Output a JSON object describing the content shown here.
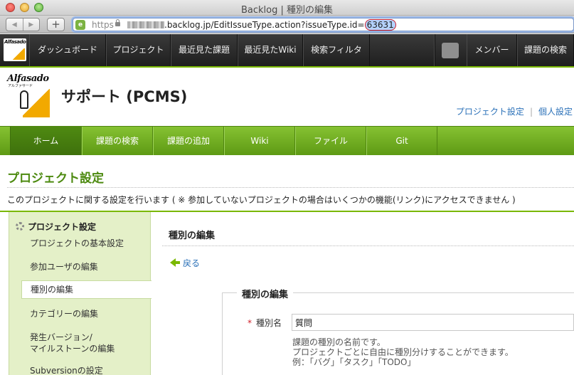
{
  "window": {
    "title": "Backlog | 種別の編集"
  },
  "address_bar": {
    "protocol": "https",
    "url_visible": ".backlog.jp/EditIssueType.action?issueType.id=",
    "url_id": "63631"
  },
  "global_nav": {
    "logo_text": "Alfasado",
    "items": [
      "ダッシュボード",
      "プロジェクト",
      "最近見た課題",
      "最近見たWiki",
      "検索フィルタ"
    ],
    "right_items": [
      "メンバー",
      "課題の検索"
    ]
  },
  "project": {
    "logo_text": "Alfasado",
    "logo_sub": "アルファサード",
    "name": "サポート (PCMS)",
    "links": [
      "プロジェクト設定",
      "個人設定"
    ]
  },
  "project_nav": {
    "items": [
      "ホーム",
      "課題の検索",
      "課題の追加",
      "Wiki",
      "ファイル",
      "Git"
    ],
    "active_index": 0
  },
  "page": {
    "title": "プロジェクト設定",
    "description": "このプロジェクトに関する設定を行います ( ※ 参加していないプロジェクトの場合はいくつかの機能(リンク)にアクセスできません )"
  },
  "sidebar": {
    "heading": "プロジェクト設定",
    "items": [
      {
        "label": "プロジェクトの基本設定"
      },
      {
        "label": "参加ユーザの編集"
      },
      {
        "label": "種別の編集",
        "active": true
      },
      {
        "label": "カテゴリーの編集"
      },
      {
        "label_line1": "発生バージョン/",
        "label_line2": "マイルストーンの編集"
      },
      {
        "label": "Subversionの設定"
      }
    ]
  },
  "main": {
    "title": "種別の編集",
    "back_label": "戻る",
    "form": {
      "legend": "種別の編集",
      "required_mark": "*",
      "field_label": "種別名",
      "field_value": "質問",
      "help_lines": [
        "課題の種別の名前です。",
        "プロジェクトごとに自由に種別分けすることができます。",
        "例：「バグ」「タスク」「TODO」"
      ]
    }
  },
  "colors": {
    "brand_green": "#7ab800",
    "title_green": "#4d8a10",
    "link_blue": "#2a70b8",
    "sidebar_bg": "#e4f0c8",
    "required_red": "#d0202a"
  }
}
